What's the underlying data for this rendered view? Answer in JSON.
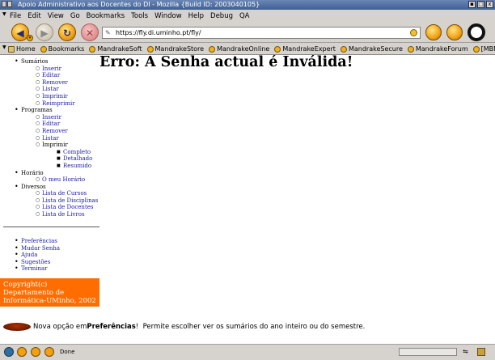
{
  "window": {
    "title": "Apoio Administrativo aos Docentes do DI - Mozilla {Build ID: 2003040105}",
    "minimize_glyph": "▪",
    "maximize_glyph": "□",
    "close_glyph": "x"
  },
  "menubar": {
    "items": [
      "File",
      "Edit",
      "View",
      "Go",
      "Bookmarks",
      "Tools",
      "Window",
      "Help",
      "Debug",
      "QA"
    ]
  },
  "navbar": {
    "url": "https://fly.di.uminho.pt/fly/"
  },
  "bookmarks": [
    "Home",
    "Bookmarks",
    "MandrakeSoft",
    "MandrakeStore",
    "MandrakeOnline",
    "MandrakeExpert",
    "MandrakeSecure",
    "MandrakeForum",
    "[MBNet]-Pagam..."
  ],
  "page": {
    "heading": "Erro: A Senha actual é Inválida!",
    "nav": [
      {
        "label": "Sumários",
        "children": [
          {
            "label": "Inserir"
          },
          {
            "label": "Editar"
          },
          {
            "label": "Remover"
          },
          {
            "label": "Listar"
          },
          {
            "label": "Imprimir"
          },
          {
            "label": "Reimprimir"
          }
        ]
      },
      {
        "label": "Programas",
        "children": [
          {
            "label": "Inserir"
          },
          {
            "label": "Editar"
          },
          {
            "label": "Remover"
          },
          {
            "label": "Listar"
          },
          {
            "label": "Imprimir",
            "plain": true,
            "children": [
              {
                "label": "Completo"
              },
              {
                "label": "Detalhado"
              },
              {
                "label": "Resumido"
              }
            ]
          }
        ]
      },
      {
        "label": "Horário",
        "children": [
          {
            "label": "O meu Horário"
          }
        ]
      },
      {
        "label": "Diversos",
        "children": [
          {
            "label": "Lista de Cursos"
          },
          {
            "label": "Lista de Disciplinas"
          },
          {
            "label": "Lista de Docentes"
          },
          {
            "label": "Lista de Livros"
          }
        ]
      }
    ],
    "menu2": [
      "Preferências",
      "Mudar Senha",
      "Ajuda",
      "Sugestões",
      "Terminar"
    ],
    "copyright": "Copyright(c) Departamento de Informática-UMinho, 2002",
    "news": {
      "prefix": "Nova opção em ",
      "strong": "Preferências",
      "suffix": "!  Permite escolher ver os sumários do ano inteiro ou do semestre."
    }
  },
  "status": {
    "text": "Done"
  },
  "colors": {
    "link": "#1a1aa6",
    "copyright_bg": "#ff6d00"
  }
}
